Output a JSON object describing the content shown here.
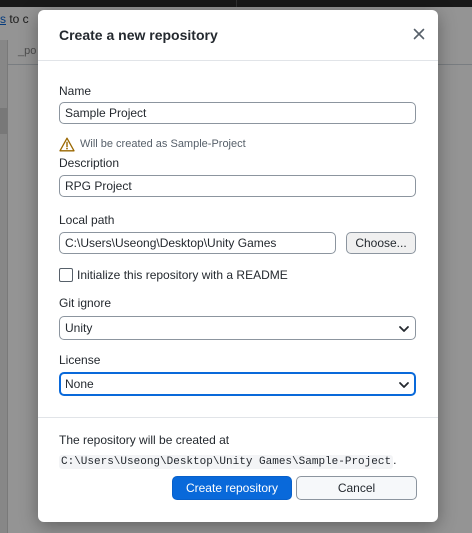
{
  "background": {
    "link_text": "s",
    "link_suffix": " to c",
    "tab_text": "_po"
  },
  "dialog": {
    "title": "Create a new repository",
    "close_icon": "close-icon",
    "name": {
      "label": "Name",
      "value": "Sample Project"
    },
    "warning": {
      "icon": "warning-triangle-icon",
      "text": "Will be created as Sample-Project"
    },
    "description": {
      "label": "Description",
      "value": "RPG Project"
    },
    "local_path": {
      "label": "Local path",
      "value": "C:\\Users\\Useong\\Desktop\\Unity Games",
      "choose_label": "Choose..."
    },
    "readme": {
      "label": "Initialize this repository with a README",
      "checked": false
    },
    "git_ignore": {
      "label": "Git ignore",
      "selected": "Unity"
    },
    "license": {
      "label": "License",
      "selected": "None"
    },
    "footer": {
      "text_prefix": "The repository will be created at ",
      "path": "C:\\Users\\Useong\\Desktop\\Unity Games\\Sample-Project",
      "text_suffix": ".",
      "create_label": "Create repository",
      "cancel_label": "Cancel"
    }
  },
  "colors": {
    "primary": "#0969da",
    "warning": "#9a6700",
    "overlay": "rgba(0,0,0,0.42)"
  }
}
